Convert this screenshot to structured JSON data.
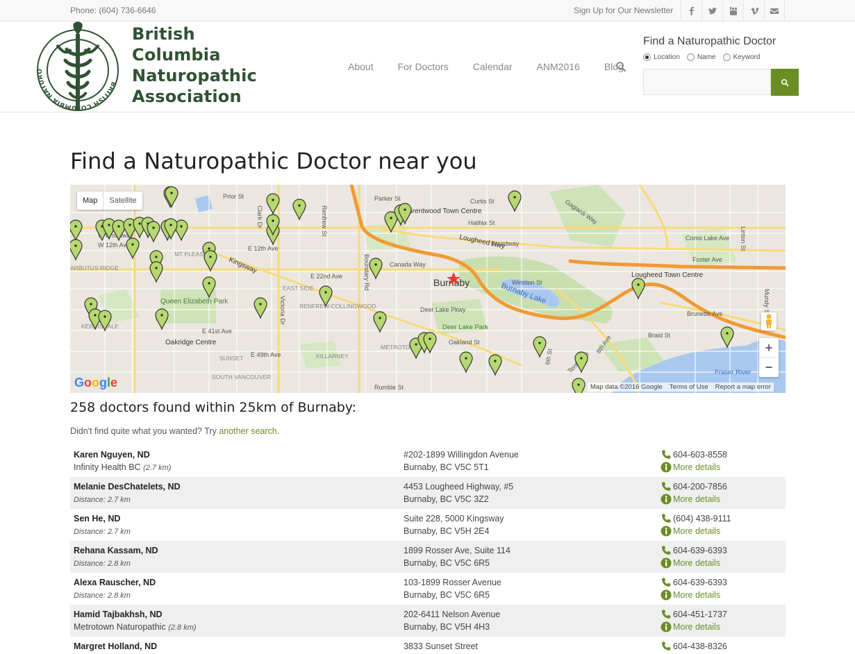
{
  "topbar": {
    "phone": "Phone: (604) 736-6646",
    "newsletter": "Sign Up for Our Newsletter",
    "social": [
      "facebook-icon",
      "twitter-icon",
      "youtube-icon",
      "vimeo-icon",
      "mail-icon"
    ]
  },
  "logo": {
    "line1": "British",
    "line2": "Columbia",
    "line3": "Naturopathic",
    "line4": "Association",
    "ring_text": "BRITISH COLUMBIA NATUROPATHIC ASSOCIATION"
  },
  "nav": {
    "items": [
      "About",
      "For Doctors",
      "Calendar",
      "ANM2016",
      "Blog"
    ]
  },
  "finder": {
    "title": "Find a Naturopathic Doctor",
    "options": [
      "Location",
      "Name",
      "Keyword"
    ],
    "selected": "Location",
    "input_value": "",
    "accent": "#6a8e23"
  },
  "page": {
    "title": "Find a Naturopathic Doctor near you"
  },
  "map": {
    "type_options": [
      "Map",
      "Satellite"
    ],
    "selected_type": "Map",
    "center_label": "Burnaby",
    "labels": [
      "Prior St",
      "Clark Dr",
      "Renfrew St",
      "Parker St",
      "Curtis St",
      "Halifax St",
      "Brentwood Town Centre",
      "Lougheed Hwy",
      "Broadway",
      "Como Lake Ave",
      "Foster Ave",
      "W Broadway",
      "W 12th Ave",
      "E 12th Ave",
      "MT PLEASANT",
      "ARBUTUS RIDGE",
      "Kingsway",
      "Canada Way",
      "Lougheed Town Centre",
      "E 22nd Ave",
      "EAST SIDE",
      "Winston St",
      "Queen Elizabeth Park",
      "RENFREW-COLLINGWOOD",
      "Burnaby Lake",
      "Deer Lake Pkwy",
      "Deer Lake Park",
      "Brunette Ave",
      "KERRISDALE",
      "E 41st Ave",
      "Oakridge Centre",
      "METROTOWN",
      "Oakland St",
      "E 49th Ave",
      "KILLARNEY",
      "SUNSET",
      "SOUTH VANCOUVER",
      "Rumble St",
      "Braid St",
      "Fraser River",
      "Tenth Ave",
      "Boundary Rd",
      "Victoria Dr",
      "Gaglardi Way",
      "6th St",
      "8th Ave",
      "Linton St",
      "Mundy St"
    ],
    "attrib": [
      "Map data ©2016 Google",
      "Terms of Use",
      "Report a map error"
    ],
    "google": "Google",
    "zoom_in": "+",
    "zoom_out": "−"
  },
  "results": {
    "heading": "258 doctors found within 25km of Burnaby:",
    "note_prefix": "Didn't find quite what you wanted? Try ",
    "note_link": "another search",
    "note_suffix": ".",
    "more_label": "More details",
    "rows": [
      {
        "name": "Karen Nguyen, ND",
        "clinic": "Infinity Health BC",
        "dist": "(2.7 km)",
        "addr1": "#202-1899 Willingdon Avenue",
        "addr2": "Burnaby, BC V5C 5T1",
        "phone": "604-603-8558"
      },
      {
        "name": "Melanie DesChatelets, ND",
        "clinic": "",
        "dist": "Distance: 2.7 km",
        "addr1": "4453 Lougheed Highway, #5",
        "addr2": "Burnaby, BC V5C 3Z2",
        "phone": "604-200-7856"
      },
      {
        "name": "Sen He, ND",
        "clinic": "",
        "dist": "Distance: 2.7 km",
        "addr1": "Suite 228, 5000 Kingsway",
        "addr2": "Burnaby, BC V5H 2E4",
        "phone": "(604) 438-9111"
      },
      {
        "name": "Rehana Kassam, ND",
        "clinic": "",
        "dist": "Distance: 2.8 km",
        "addr1": "1899 Rosser Ave, Suite 114",
        "addr2": "Burnaby, BC V5C 6R5",
        "phone": "604-639-6393"
      },
      {
        "name": "Alexa Rauscher, ND",
        "clinic": "",
        "dist": "Distance: 2.8 km",
        "addr1": "103-1899 Rosser Avenue",
        "addr2": "Burnaby, BC V5C 6R5",
        "phone": "604-639-6393"
      },
      {
        "name": "Hamid Tajbakhsh, ND",
        "clinic": "Metrotown Naturopathic",
        "dist": "(2.8 km)",
        "addr1": "202-6411 Nelson Avenue",
        "addr2": "Burnaby, BC V5H 4H3",
        "phone": "604-451-1737"
      },
      {
        "name": "Margret Holland, ND",
        "clinic": "",
        "dist": "",
        "addr1": "3833 Sunset Street",
        "addr2": "",
        "phone": "604-438-8326"
      }
    ]
  }
}
